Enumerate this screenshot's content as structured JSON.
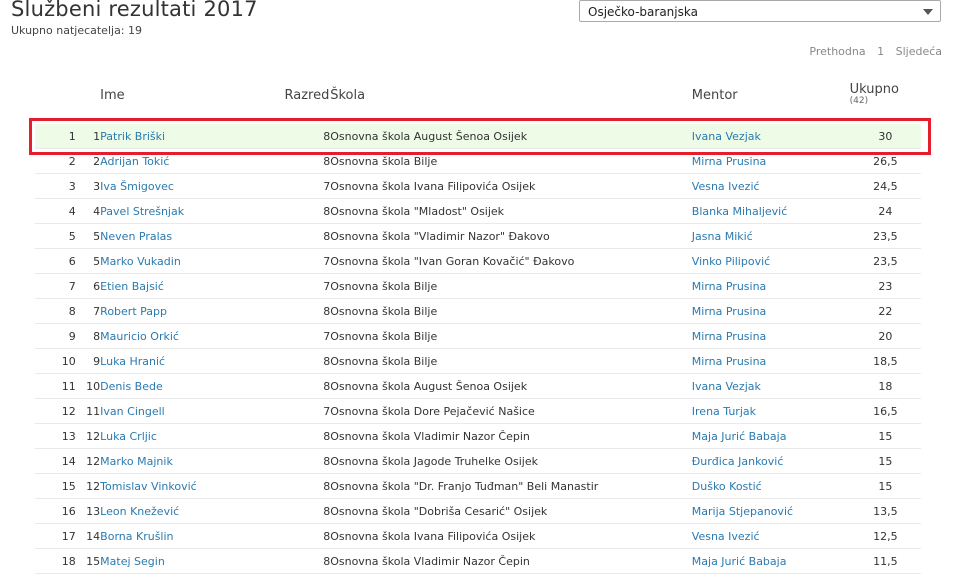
{
  "header": {
    "title": "Službeni rezultati 2017",
    "subtitle": "Ukupno natjecatelja: 19"
  },
  "region_select": {
    "value": "Osječko-baranjska"
  },
  "pager": {
    "prev": "Prethodna",
    "current": "1",
    "next": "Sljedeća"
  },
  "table": {
    "columns": {
      "name": "Ime",
      "grade": "Razred",
      "school": "Škola",
      "mentor": "Mentor",
      "total": "Ukupno",
      "total_max": "(42)"
    },
    "rows": [
      {
        "rank": "1",
        "place": "1",
        "name": "Patrik Briški",
        "grade": "8",
        "school": "Osnovna škola August Šenoa Osijek",
        "mentor": "Ivana Vezjak",
        "total": "30"
      },
      {
        "rank": "2",
        "place": "2",
        "name": "Adrijan Tokić",
        "grade": "8",
        "school": "Osnovna škola Bilje",
        "mentor": "Mirna Prusina",
        "total": "26,5"
      },
      {
        "rank": "3",
        "place": "3",
        "name": "Iva Šmigovec",
        "grade": "7",
        "school": "Osnovna škola Ivana Filipovića Osijek",
        "mentor": "Vesna Ivezić",
        "total": "24,5"
      },
      {
        "rank": "4",
        "place": "4",
        "name": "Pavel Strešnjak",
        "grade": "8",
        "school": "Osnovna škola \"Mladost\" Osijek",
        "mentor": "Blanka Mihaljević",
        "total": "24"
      },
      {
        "rank": "5",
        "place": "5",
        "name": "Neven Pralas",
        "grade": "8",
        "school": "Osnovna škola \"Vladimir Nazor\" Đakovo",
        "mentor": "Jasna Mikić",
        "total": "23,5"
      },
      {
        "rank": "6",
        "place": "5",
        "name": "Marko Vukadin",
        "grade": "7",
        "school": "Osnovna škola \"Ivan Goran Kovačić\" Đakovo",
        "mentor": "Vinko Pilipović",
        "total": "23,5"
      },
      {
        "rank": "7",
        "place": "6",
        "name": "Etien Bajsić",
        "grade": "7",
        "school": "Osnovna škola Bilje",
        "mentor": "Mirna Prusina",
        "total": "23"
      },
      {
        "rank": "8",
        "place": "7",
        "name": "Robert Papp",
        "grade": "8",
        "school": "Osnovna škola Bilje",
        "mentor": "Mirna Prusina",
        "total": "22"
      },
      {
        "rank": "9",
        "place": "8",
        "name": "Mauricio Orkić",
        "grade": "7",
        "school": "Osnovna škola Bilje",
        "mentor": "Mirna Prusina",
        "total": "20"
      },
      {
        "rank": "10",
        "place": "9",
        "name": "Luka Hranić",
        "grade": "8",
        "school": "Osnovna škola Bilje",
        "mentor": "Mirna Prusina",
        "total": "18,5"
      },
      {
        "rank": "11",
        "place": "10",
        "name": "Denis Bede",
        "grade": "8",
        "school": "Osnovna škola August Šenoa Osijek",
        "mentor": "Ivana Vezjak",
        "total": "18"
      },
      {
        "rank": "12",
        "place": "11",
        "name": "Ivan Cingell",
        "grade": "7",
        "school": "Osnovna škola Dore Pejačević Našice",
        "mentor": "Irena Turjak",
        "total": "16,5"
      },
      {
        "rank": "13",
        "place": "12",
        "name": "Luka Crljic",
        "grade": "8",
        "school": "Osnovna škola Vladimir Nazor Čepin",
        "mentor": "Maja Jurić Babaja",
        "total": "15"
      },
      {
        "rank": "14",
        "place": "12",
        "name": "Marko Majnik",
        "grade": "8",
        "school": "Osnovna škola Jagode Truhelke Osijek",
        "mentor": "Đurđica Janković",
        "total": "15"
      },
      {
        "rank": "15",
        "place": "12",
        "name": "Tomislav Vinković",
        "grade": "8",
        "school": "Osnovna škola \"Dr. Franjo Tuđman\" Beli Manastir",
        "mentor": "Duško Kostić",
        "total": "15"
      },
      {
        "rank": "16",
        "place": "13",
        "name": "Leon Knežević",
        "grade": "8",
        "school": "Osnovna škola \"Dobriša Cesarić\" Osijek",
        "mentor": "Marija Stjepanović",
        "total": "13,5"
      },
      {
        "rank": "17",
        "place": "14",
        "name": "Borna Krušlin",
        "grade": "8",
        "school": "Osnovna škola Ivana Filipovića Osijek",
        "mentor": "Vesna Ivezić",
        "total": "12,5"
      },
      {
        "rank": "18",
        "place": "15",
        "name": "Matej Segin",
        "grade": "8",
        "school": "Osnovna škola Vladimir Nazor Čepin",
        "mentor": "Maja Jurić Babaja",
        "total": "11,5"
      }
    ]
  },
  "colors": {
    "link": "#2a7ab0",
    "highlight_row": "#eefbe7",
    "annotation_box": "#e41e2a"
  }
}
